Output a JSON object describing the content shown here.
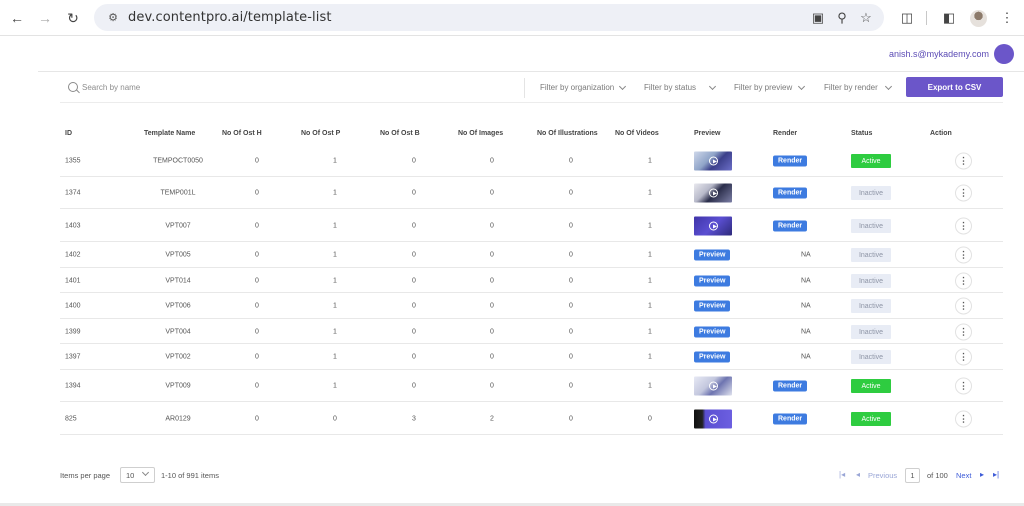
{
  "browser": {
    "url": "dev.contentpro.ai/template-list"
  },
  "header": {
    "user_email": "anish.s@mykademy.com"
  },
  "filters": {
    "search_placeholder": "Search by name",
    "organization": "Filter by organization",
    "status": "Filter by status",
    "preview": "Filter by preview",
    "render": "Filter by render",
    "export_label": "Export to CSV"
  },
  "colors": {
    "accent": "#6b56c9",
    "button_blue": "#3d7be0",
    "active_green": "#2ecc40",
    "inactive_bg": "#e8ecf5"
  },
  "table": {
    "columns": [
      "ID",
      "Template Name",
      "No Of Ost H",
      "No Of Ost P",
      "No Of Ost B",
      "No Of Images",
      "No Of Illustrations",
      "No Of Videos",
      "Preview",
      "Render",
      "Status",
      "Action"
    ],
    "rows": [
      {
        "id": "1355",
        "name": "TEMPOCT0050",
        "ost_h": "0",
        "ost_p": "1",
        "ost_b": "0",
        "images": "0",
        "illustrations": "0",
        "videos": "1",
        "preview": "thumbnail",
        "render": "Render",
        "status": "Active"
      },
      {
        "id": "1374",
        "name": "TEMP001L",
        "ost_h": "0",
        "ost_p": "1",
        "ost_b": "0",
        "images": "0",
        "illustrations": "0",
        "videos": "1",
        "preview": "thumbnail",
        "render": "Render",
        "status": "Inactive"
      },
      {
        "id": "1403",
        "name": "VPT007",
        "ost_h": "0",
        "ost_p": "1",
        "ost_b": "0",
        "images": "0",
        "illustrations": "0",
        "videos": "1",
        "preview": "thumbnail",
        "render": "Render",
        "status": "Inactive"
      },
      {
        "id": "1402",
        "name": "VPT005",
        "ost_h": "0",
        "ost_p": "1",
        "ost_b": "0",
        "images": "0",
        "illustrations": "0",
        "videos": "1",
        "preview": "Preview",
        "render": "NA",
        "status": "Inactive"
      },
      {
        "id": "1401",
        "name": "VPT014",
        "ost_h": "0",
        "ost_p": "1",
        "ost_b": "0",
        "images": "0",
        "illustrations": "0",
        "videos": "1",
        "preview": "Preview",
        "render": "NA",
        "status": "Inactive"
      },
      {
        "id": "1400",
        "name": "VPT006",
        "ost_h": "0",
        "ost_p": "1",
        "ost_b": "0",
        "images": "0",
        "illustrations": "0",
        "videos": "1",
        "preview": "Preview",
        "render": "NA",
        "status": "Inactive"
      },
      {
        "id": "1399",
        "name": "VPT004",
        "ost_h": "0",
        "ost_p": "1",
        "ost_b": "0",
        "images": "0",
        "illustrations": "0",
        "videos": "1",
        "preview": "Preview",
        "render": "NA",
        "status": "Inactive"
      },
      {
        "id": "1397",
        "name": "VPT002",
        "ost_h": "0",
        "ost_p": "1",
        "ost_b": "0",
        "images": "0",
        "illustrations": "0",
        "videos": "1",
        "preview": "Preview",
        "render": "NA",
        "status": "Inactive"
      },
      {
        "id": "1394",
        "name": "VPT009",
        "ost_h": "0",
        "ost_p": "1",
        "ost_b": "0",
        "images": "0",
        "illustrations": "0",
        "videos": "1",
        "preview": "thumbnail",
        "render": "Render",
        "status": "Active"
      },
      {
        "id": "825",
        "name": "AR0129",
        "ost_h": "0",
        "ost_p": "0",
        "ost_b": "3",
        "images": "2",
        "illustrations": "0",
        "videos": "0",
        "preview": "thumbnail",
        "render": "Render",
        "status": "Active"
      }
    ]
  },
  "footer": {
    "items_per_page_label": "Items per page",
    "per_page_value": "10",
    "range_text": "1-10 of 991 items",
    "previous": "Previous",
    "page_value": "1",
    "of_pages": "of 100",
    "next": "Next"
  }
}
